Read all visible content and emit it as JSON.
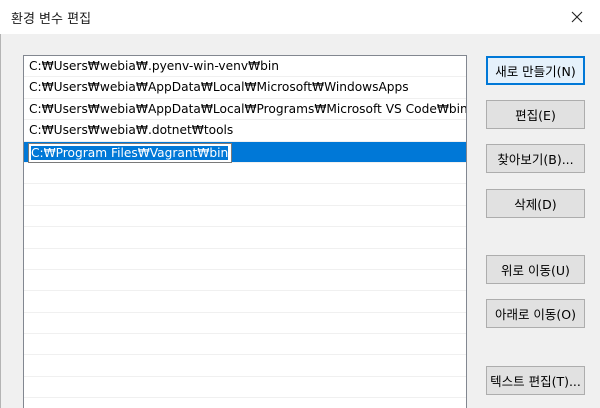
{
  "window": {
    "title": "환경 변수 편집"
  },
  "paths": [
    "C:₩Users₩webia₩.pyenv-win-venv₩bin",
    "C:₩Users₩webia₩AppData₩Local₩Microsoft₩WindowsApps",
    "C:₩Users₩webia₩AppData₩Local₩Programs₩Microsoft VS Code₩bin",
    "C:₩Users₩webia₩.dotnet₩tools"
  ],
  "editing": {
    "value": "C:₩Program Files₩Vagrant₩bin"
  },
  "buttons": {
    "new": "새로 만들기(N)",
    "edit": "편집(E)",
    "browse": "찾아보기(B)...",
    "delete": "삭제(D)",
    "move_up": "위로 이동(U)",
    "move_down": "아래로 이동(O)",
    "edit_text": "텍스트 편집(T)..."
  },
  "colors": {
    "selection": "#0078d7",
    "button_face": "#e1e1e1",
    "dialog_background": "#f0f0f0"
  },
  "icons": {
    "close": "close-icon"
  }
}
